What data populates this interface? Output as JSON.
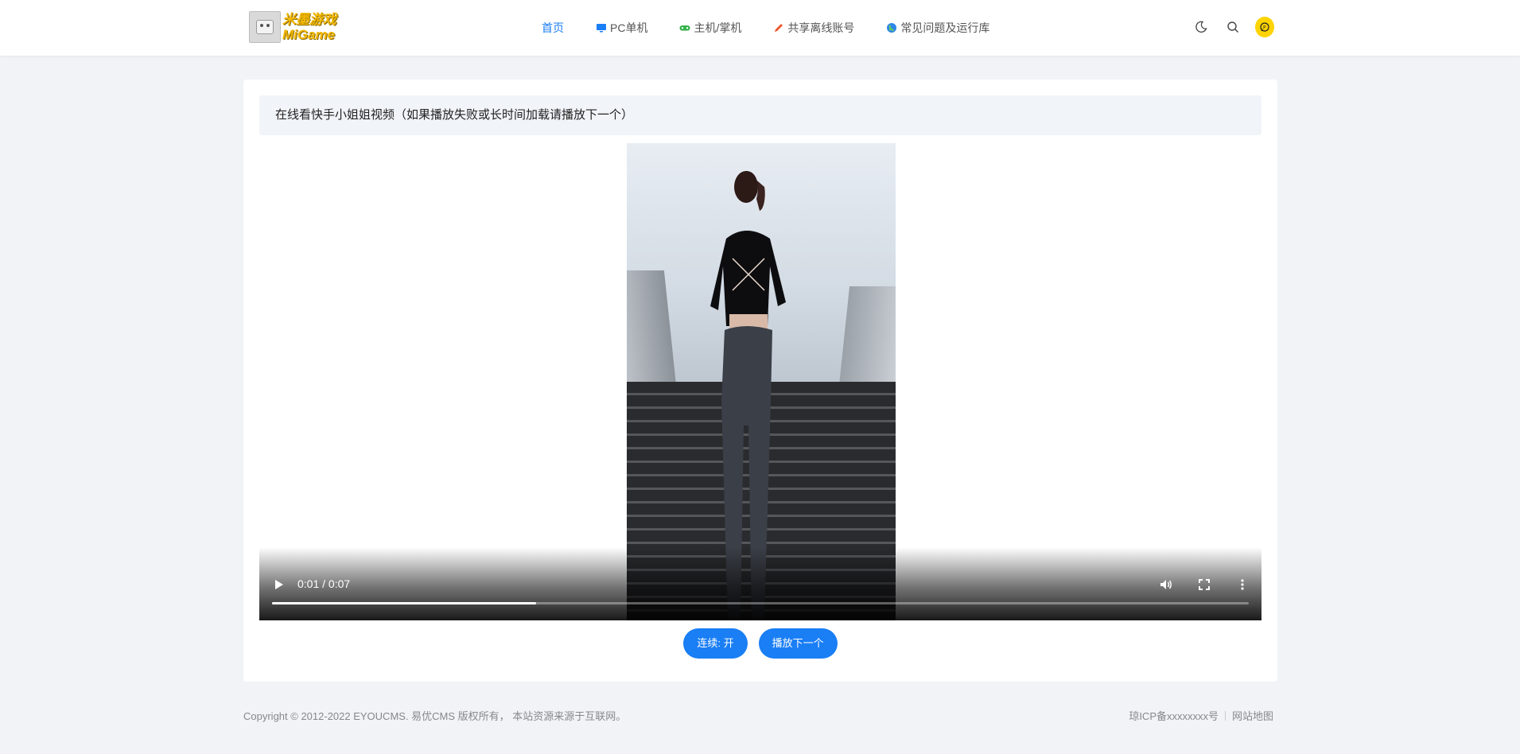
{
  "header": {
    "logo": {
      "title": "米墨游戏",
      "subtitle": "MiGame"
    },
    "nav": [
      {
        "label": "首页",
        "icon": "none",
        "active": true
      },
      {
        "label": "PC单机",
        "icon": "monitor-icon",
        "active": false
      },
      {
        "label": "主机/掌机",
        "icon": "gamepad-icon",
        "active": false
      },
      {
        "label": "共享离线账号",
        "icon": "pencil-icon",
        "active": false
      },
      {
        "label": "常见问题及运行库",
        "icon": "globe-icon",
        "active": false
      }
    ],
    "tools": [
      "dark-mode-icon",
      "search-icon",
      "message-icon"
    ]
  },
  "main": {
    "notice": "在线看快手小姐姐视频（如果播放失败或长时间加载请播放下一个）",
    "player": {
      "time": "0:01 / 0:07",
      "progress": 0.27
    },
    "buttons": {
      "continuous": "连续: 开",
      "next": "播放下一个"
    }
  },
  "footer": {
    "copyright": "Copyright © 2012-2022 EYOUCMS. 易优CMS 版权所有， 本站资源来源于互联网。",
    "icp": "琼ICP备xxxxxxxx号",
    "sitemap": "网站地图"
  },
  "colors": {
    "accent": "#1a7ef5",
    "background": "#f1f3f7",
    "message_button": "#ffd400"
  }
}
